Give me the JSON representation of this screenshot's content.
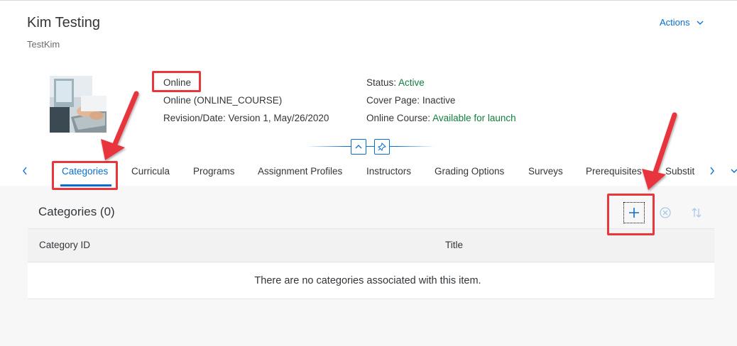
{
  "header": {
    "title": "Kim Testing",
    "subtitle": "TestKim",
    "actions_label": "Actions"
  },
  "details": {
    "delivery_type": "Online",
    "delivery_method": "Online (ONLINE_COURSE)",
    "revision": "Revision/Date: Version 1, May/26/2020",
    "status_label": "Status:",
    "status_value": "Active",
    "cover_label": "Cover Page:",
    "cover_value": "Inactive",
    "online_label": "Online Course:",
    "online_value": "Available for launch"
  },
  "tabs": [
    {
      "label": "Categories",
      "active": true
    },
    {
      "label": "Curricula"
    },
    {
      "label": "Programs"
    },
    {
      "label": "Assignment Profiles"
    },
    {
      "label": "Instructors"
    },
    {
      "label": "Grading Options"
    },
    {
      "label": "Surveys"
    },
    {
      "label": "Prerequisites"
    },
    {
      "label": "Substit"
    }
  ],
  "panel": {
    "title": "Categories (0)",
    "columns": [
      "Category ID",
      "Title"
    ],
    "empty_message": "There are no categories associated with this item."
  },
  "icons": {
    "actions": "chevron-down-icon",
    "collapse": "chevron-up-icon",
    "pin": "pin-icon",
    "add": "plus-icon",
    "remove": "circle-x-icon",
    "sort": "sort-icon"
  },
  "colors": {
    "accent": "#0a6ed1",
    "positive": "#107e3e",
    "annotation": "#e8363d"
  }
}
